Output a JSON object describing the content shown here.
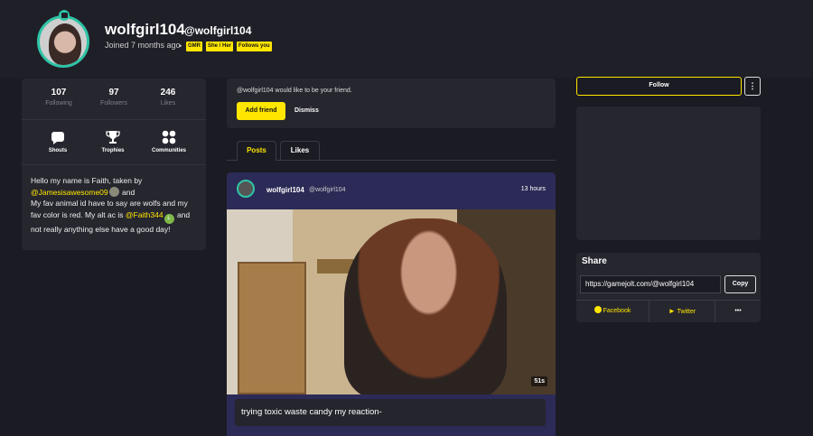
{
  "profile": {
    "display_name": "wolfgirl104",
    "handle": "@wolfgirl104",
    "joined": "Joined 7 months ago",
    "separator": "•",
    "tags": [
      "GMR",
      "She / Her",
      "Follows you"
    ]
  },
  "stats": [
    {
      "value": "107",
      "label": "Following"
    },
    {
      "value": "97",
      "label": "Followers"
    },
    {
      "value": "246",
      "label": "Likes"
    }
  ],
  "nav": [
    {
      "label": "Shouts",
      "icon": "speech-bubble-icon"
    },
    {
      "label": "Trophies",
      "icon": "trophy-icon"
    },
    {
      "label": "Communities",
      "icon": "grid-icon"
    }
  ],
  "bio": {
    "line1": "Hello my name is Faith,  taken by",
    "mention1": "@Jamesisawesome09",
    "and": "and",
    "line2": " My fav animal id have to say are wolfs and my fav color is red. My alt ac is ",
    "mention2": "@Faith344",
    "mention2_badge": "L",
    "line3": " and not really anything else have a good day!"
  },
  "friend_request": {
    "message": "@wolfgirl104 would like to be your friend.",
    "accept_label": "Add friend",
    "dismiss_label": "Dismiss"
  },
  "tabs": [
    {
      "label": "Posts",
      "active": true
    },
    {
      "label": "Likes",
      "active": false
    }
  ],
  "post": {
    "author": "wolfgirl104",
    "author_handle": "@wolfgirl104",
    "time": "13 hours",
    "duration": "51s",
    "caption": "trying toxic waste candy my reaction-"
  },
  "actions": {
    "follow_label": "Follow",
    "more_label": "⋮"
  },
  "share": {
    "title": "Share",
    "url": "https://gamejolt.com/@wolfgirl104",
    "copy_label": "Copy",
    "facebook_label": "Facebook",
    "twitter_label": "Twitter",
    "more_label": "•••"
  },
  "colors": {
    "accent": "#ffe600",
    "teal": "#2ec4a6",
    "background": "#1b1b23",
    "card": "#26262f"
  }
}
